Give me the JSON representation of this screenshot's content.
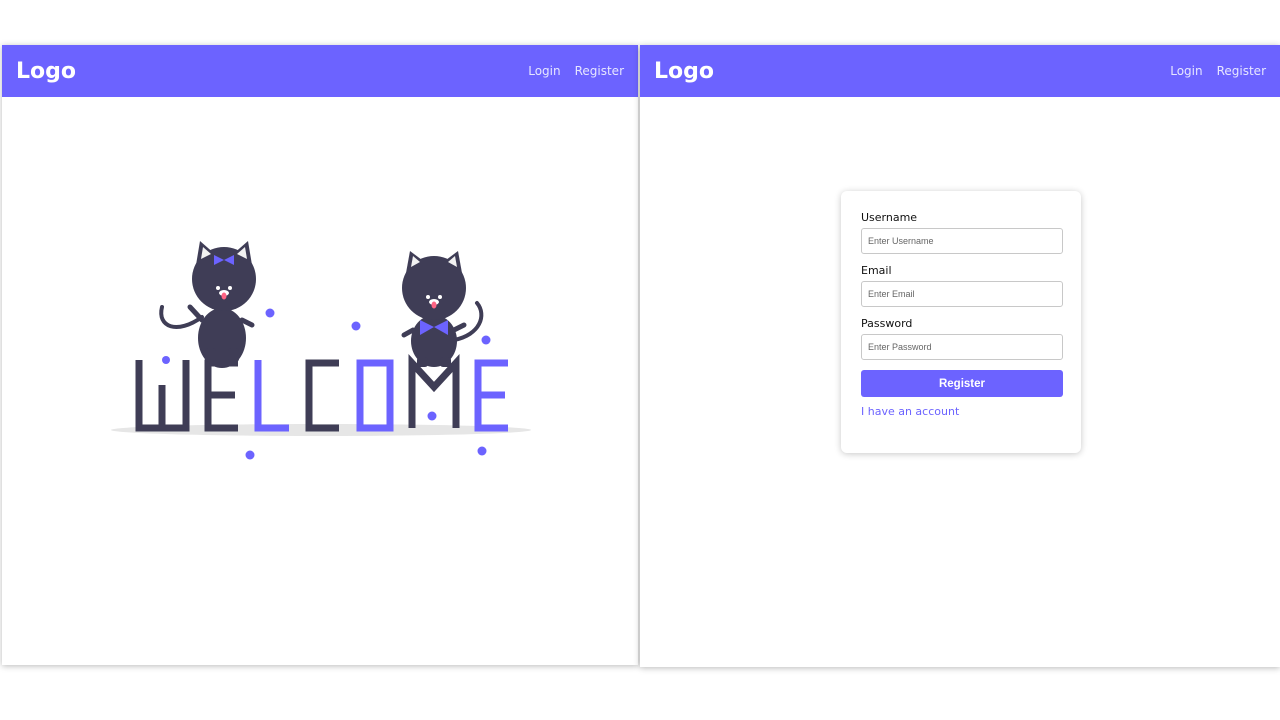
{
  "colors": {
    "accent": "#6c63ff",
    "dark": "#3f3d56",
    "ground": "#e6e6e6",
    "tongue": "#ff6584",
    "ear_inner": "#f2f2f2",
    "white": "#ffffff"
  },
  "left_screen": {
    "navbar": {
      "logo": "Logo",
      "links": [
        {
          "label": "Login"
        },
        {
          "label": "Register"
        }
      ]
    },
    "illustration": {
      "letters": [
        {
          "char": "W",
          "color": "dark"
        },
        {
          "char": "E",
          "color": "dark"
        },
        {
          "char": "L",
          "color": "accent"
        },
        {
          "char": "C",
          "color": "dark"
        },
        {
          "char": "O",
          "color": "accent"
        },
        {
          "char": "M",
          "color": "dark"
        },
        {
          "char": "E",
          "color": "accent"
        }
      ]
    }
  },
  "right_screen": {
    "navbar": {
      "logo": "Logo",
      "links": [
        {
          "label": "Login"
        },
        {
          "label": "Register"
        }
      ]
    },
    "form": {
      "username_label": "Username",
      "username_placeholder": "Enter Username",
      "email_label": "Email",
      "email_placeholder": "Enter Email",
      "password_label": "Password",
      "password_placeholder": "Enter Password",
      "submit_label": "Register",
      "account_link": "I have an account"
    }
  }
}
